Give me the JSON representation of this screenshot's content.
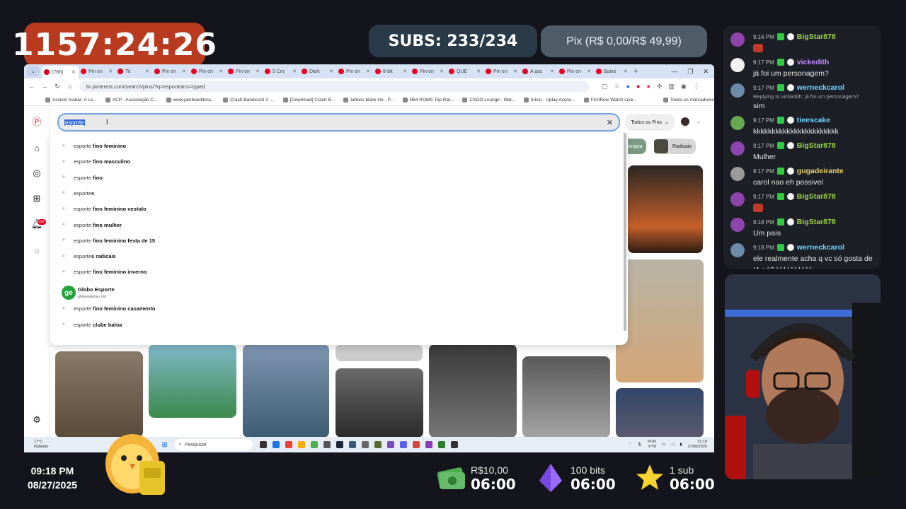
{
  "overlay": {
    "timer": "1157:24:26",
    "subs": "SUBS: 233/234",
    "pix": "Pix (R$ 0,00/R$ 49,99)",
    "clock_time": "09:18 PM",
    "clock_date": "08/27/2025",
    "goals": [
      {
        "top": "R$10,00",
        "bottom": "06:00",
        "icon": "money-icon"
      },
      {
        "top": "100 bits",
        "bottom": "06:00",
        "icon": "bits-gem-icon"
      },
      {
        "top": "1 sub",
        "bottom": "06:00",
        "icon": "star-icon"
      }
    ]
  },
  "chat": {
    "messages": [
      {
        "time": "9:16 PM",
        "user": "BigStar878",
        "user_color": "#9cd34a",
        "text": ""
      },
      {
        "time": "9:17 PM",
        "user": "vickedith",
        "user_color": "#c58bff",
        "text": "já foi um personagem?"
      },
      {
        "time": "9:17 PM",
        "user": "werneckcarol",
        "user_color": "#6fd6ff",
        "reply": "Replying to vickedith: já foi um personagem?",
        "text": "sim"
      },
      {
        "time": "9:17 PM",
        "user": "tieescake",
        "user_color": "#6fd6ff",
        "text": "kkkkkkkkkkkkkkkkkkkkkkk"
      },
      {
        "time": "9:17 PM",
        "user": "BigStar878",
        "user_color": "#9cd34a",
        "text": "Mulher"
      },
      {
        "time": "9:17 PM",
        "user": "gugadeirante",
        "user_color": "#e6d26a",
        "text": "carol nao eh possivel"
      },
      {
        "time": "9:17 PM",
        "user": "BigStar878",
        "user_color": "#9cd34a",
        "text": ""
      },
      {
        "time": "9:18 PM",
        "user": "BigStar878",
        "user_color": "#9cd34a",
        "text": "Um país"
      },
      {
        "time": "9:18 PM",
        "user": "werneckcarol",
        "user_color": "#6fd6ff",
        "text": "ele realmente acha q vc só gosta de IA né? kkkkkkkkkk"
      }
    ]
  },
  "browser": {
    "tabs": [
      "(766)",
      "Pin en",
      "Tit",
      "Pin en",
      "Pin en",
      "Pin en",
      "5 Cre",
      "Dark",
      "Pin en",
      "8-bit",
      "Pin en",
      "QUE",
      "Pin en",
      "A asc",
      "Pin en",
      "Baixe"
    ],
    "url": "br.pinterest.com/search/pins/?q=esporte&rs=typed",
    "bookmarks": [
      "Assistir Avatar: A Le...",
      "ACP - Associação C...",
      "www.jamboeditora...",
      "Crash Bandicoot 3 -...",
      "[Download] Crash B...",
      "tattoos black ink - P...",
      "N64 ROMS Top Rat...",
      "CSGO Lounge - Mar...",
      "Início - Uplay Accou...",
      "FirstRow Watch Live...",
      "Todos os marcadores"
    ],
    "search_value": "esporte",
    "filter_label": "Todos os Pins",
    "chips": [
      "terapia",
      "Radicais"
    ],
    "suggestions": [
      {
        "prefix": "esporte",
        "suffix": " fino feminino"
      },
      {
        "prefix": "esporte",
        "suffix": " fino masculino"
      },
      {
        "prefix": "esporte",
        "suffix": " fino"
      },
      {
        "prefix": "esporte",
        "suffix": "s"
      },
      {
        "prefix": "esporte",
        "suffix": " fino feminino vestido"
      },
      {
        "prefix": "esporte",
        "suffix": " fino mulher"
      },
      {
        "prefix": "esporte",
        "suffix": " fino feminino festa de 15"
      },
      {
        "prefix": "esporte",
        "suffix": "s radicais"
      },
      {
        "prefix": "esporte",
        "suffix": " fino feminino inverno"
      }
    ],
    "site_suggestion": {
      "badge": "ge",
      "title": "Globo Esporte",
      "url": "globoesporte.com"
    },
    "suggestions_after": [
      {
        "prefix": "esporte",
        "suffix": " fino feminino casamento"
      },
      {
        "prefix": "esporte",
        "suffix": " clube bahia"
      }
    ],
    "notification_count": "99+"
  },
  "taskbar": {
    "weather_temp": "17°C",
    "weather_desc": "Nublado",
    "search_placeholder": "Pesquisar",
    "lang_1": "POR",
    "lang_2": "PTB",
    "time": "21:18",
    "date": "27/08/2025"
  }
}
